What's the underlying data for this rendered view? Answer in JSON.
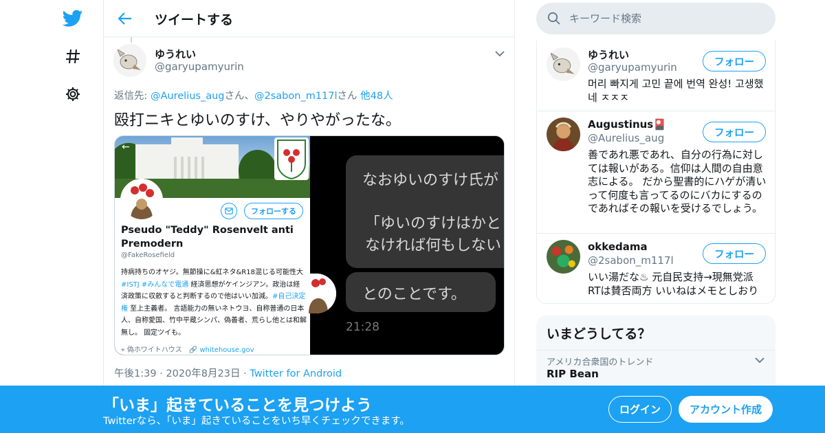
{
  "colors": {
    "accent": "#1da1f2",
    "text": "#14171a",
    "muted": "#657786",
    "border": "#e6ecf0",
    "banner": "#1da1f2"
  },
  "nav": {
    "logo_icon": "twitter-bird-icon",
    "explore_icon": "hashtag-icon",
    "settings_icon": "gear-icon"
  },
  "header": {
    "back_icon": "arrow-left-icon",
    "title": "ツイートする"
  },
  "tweet": {
    "author_name": "ゆうれい",
    "author_handle": "@garyupamyurin",
    "reply_prefix": "返信先: ",
    "reply_user1": "@Aurelius_aug",
    "reply_sep1": "さん、",
    "reply_user2": "@2sabon_m117l",
    "reply_sep2": "さん ",
    "reply_others": "他48人",
    "text": "殴打ニキとゆいのすけ、やりやがったな。",
    "time": "午後1:39",
    "date": "2020年8月23日",
    "source": "Twitter for Android",
    "dot": "·"
  },
  "media_profile": {
    "follow_label": "フォローする",
    "name": "Pseudo \"Teddy\" Rosenvelt anti Premodern",
    "handle": "@FakeRosefield",
    "bio_1": "持病持ちのオヤジ。無節操に&虹ネタ&R18混じる可能性大 ",
    "bio_tag1": "#ISTJ",
    "bio_tag2": "#みんなで電通",
    "bio_2": " 経済思想がケインジアン。政治は経済政策に収斂すると判断するので他はいい加減。",
    "bio_tag3": "#自己決定権",
    "bio_3": " 至上主義者。 言語能力の無いネトウヨ、自称普通の日本人、自称愛国、竹中平蔵シンパ、偽善者、荒らし他とは和解無し。 固定ツイも。",
    "location": "偽ホワイトハウス",
    "website": "whitehouse.gov"
  },
  "media_chat": {
    "line1": "なおゆいのすけ氏が",
    "line2a": "「ゆいのすけはかと",
    "line2b": "なければ何もしない",
    "line3": "とのことです。",
    "time": "21:28"
  },
  "search": {
    "placeholder": "キーワード検索"
  },
  "who_to_follow": [
    {
      "name": "ゆうれい",
      "handle": "@garyupamyurin",
      "bio": "머리 빠지게 고민 끝에 번역 완성! 고생했네 ㅈㅈㅈ",
      "follow": "フォロー"
    },
    {
      "name": "Augustinus🎴",
      "handle": "@Aurelius_aug",
      "bio": "善であれ悪であれ、自分の行為に対しては報いがある。信仰は人間の自由意志による。 だから聖書的にハゲが清いって何度も言ってるのにバカにするのであればその報いを受けるでしょう。",
      "follow": "フォロー"
    },
    {
      "name": "okkedama",
      "handle": "@2sabon_m117l",
      "bio": "いい湯だな♨ 元自民支持→現無党派 RTは賛否両方 いいねはメモとしおり",
      "follow": "フォロー"
    }
  ],
  "trends": {
    "title": "いまどうしてる？",
    "context": "アメリカ合衆国のトレンド",
    "name": "RIP Bean"
  },
  "bottom_banner": {
    "title": "「いま」起きていることを見つけよう",
    "subtitle": "Twitterなら、「いま」起きていることをいち早くチェックできます。",
    "login": "ログイン",
    "signup": "アカウント作成"
  }
}
